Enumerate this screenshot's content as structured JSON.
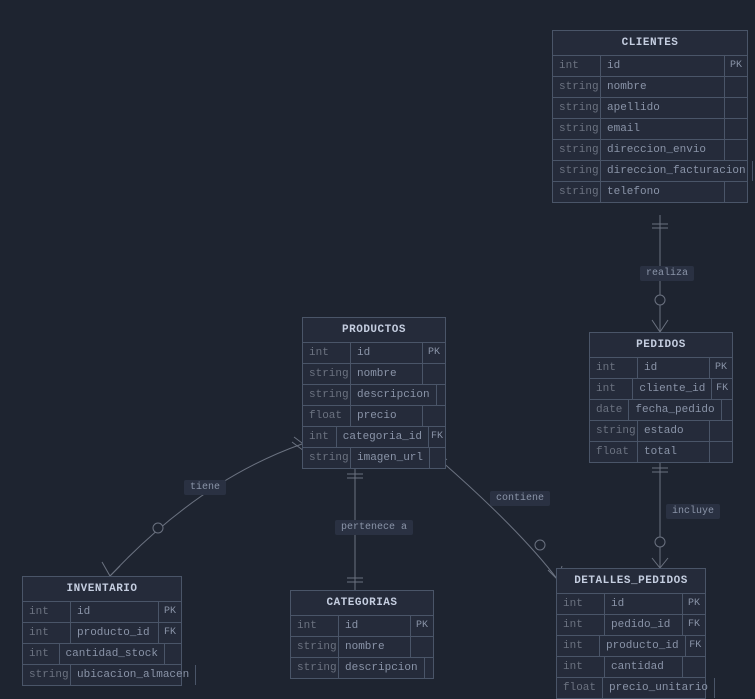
{
  "entities": {
    "clientes": {
      "title": "CLIENTES",
      "rows": [
        {
          "type": "int",
          "name": "id",
          "key": "PK"
        },
        {
          "type": "string",
          "name": "nombre",
          "key": ""
        },
        {
          "type": "string",
          "name": "apellido",
          "key": ""
        },
        {
          "type": "string",
          "name": "email",
          "key": ""
        },
        {
          "type": "string",
          "name": "direccion_envio",
          "key": ""
        },
        {
          "type": "string",
          "name": "direccion_facturacion",
          "key": ""
        },
        {
          "type": "string",
          "name": "telefono",
          "key": ""
        }
      ]
    },
    "pedidos": {
      "title": "PEDIDOS",
      "rows": [
        {
          "type": "int",
          "name": "id",
          "key": "PK"
        },
        {
          "type": "int",
          "name": "cliente_id",
          "key": "FK"
        },
        {
          "type": "date",
          "name": "fecha_pedido",
          "key": ""
        },
        {
          "type": "string",
          "name": "estado",
          "key": ""
        },
        {
          "type": "float",
          "name": "total",
          "key": ""
        }
      ]
    },
    "productos": {
      "title": "PRODUCTOS",
      "rows": [
        {
          "type": "int",
          "name": "id",
          "key": "PK"
        },
        {
          "type": "string",
          "name": "nombre",
          "key": ""
        },
        {
          "type": "string",
          "name": "descripcion",
          "key": ""
        },
        {
          "type": "float",
          "name": "precio",
          "key": ""
        },
        {
          "type": "int",
          "name": "categoria_id",
          "key": "FK"
        },
        {
          "type": "string",
          "name": "imagen_url",
          "key": ""
        }
      ]
    },
    "categorias": {
      "title": "CATEGORIAS",
      "rows": [
        {
          "type": "int",
          "name": "id",
          "key": "PK"
        },
        {
          "type": "string",
          "name": "nombre",
          "key": ""
        },
        {
          "type": "string",
          "name": "descripcion",
          "key": ""
        }
      ]
    },
    "detalles_pedidos": {
      "title": "DETALLES_PEDIDOS",
      "rows": [
        {
          "type": "int",
          "name": "id",
          "key": "PK"
        },
        {
          "type": "int",
          "name": "pedido_id",
          "key": "FK"
        },
        {
          "type": "int",
          "name": "producto_id",
          "key": "FK"
        },
        {
          "type": "int",
          "name": "cantidad",
          "key": ""
        },
        {
          "type": "float",
          "name": "precio_unitario",
          "key": ""
        }
      ]
    },
    "inventario": {
      "title": "INVENTARIO",
      "rows": [
        {
          "type": "int",
          "name": "id",
          "key": "PK"
        },
        {
          "type": "int",
          "name": "producto_id",
          "key": "FK"
        },
        {
          "type": "int",
          "name": "cantidad_stock",
          "key": ""
        },
        {
          "type": "string",
          "name": "ubicacion_almacen",
          "key": ""
        }
      ]
    }
  },
  "labels": {
    "realiza": "realiza",
    "incluye": "incluye",
    "contiene": "contiene",
    "pertenece_a": "pertenece a",
    "tiene": "tiene"
  }
}
